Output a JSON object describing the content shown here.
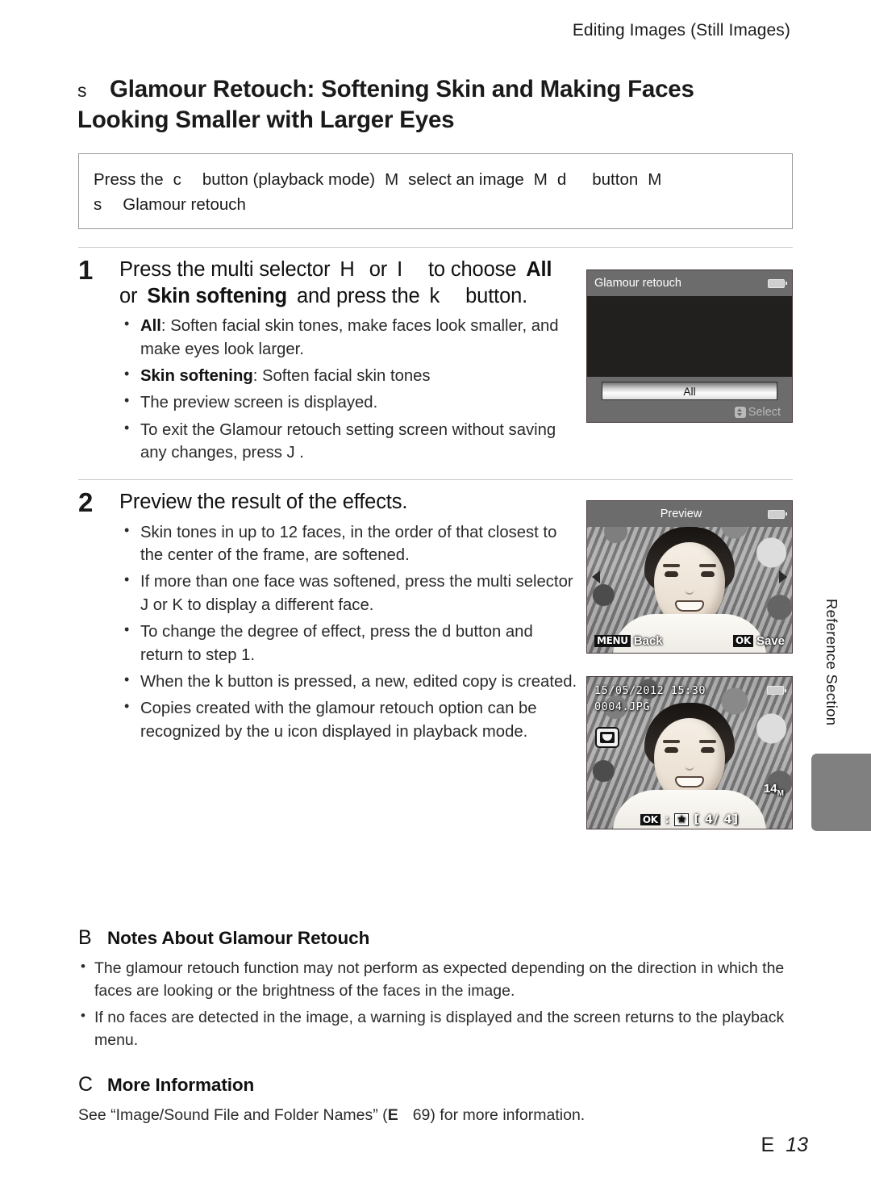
{
  "header": {
    "running_head": "Editing Images (Still Images)"
  },
  "section": {
    "symbol": "s",
    "title_line1": "Glamour Retouch: Softening Skin and Making Faces",
    "title_line2": "Looking Smaller with Larger Eyes"
  },
  "path_box": {
    "line1_a": "Press the",
    "line1_btn1": "c",
    "line1_b": "button (playback mode)",
    "line1_arrow1": "M",
    "line1_c": "select an image",
    "line1_arrow2": "M",
    "line1_btn2": "d",
    "line1_d": "button",
    "line1_arrow3": "M",
    "line2_sym": "s",
    "line2_text": "Glamour retouch"
  },
  "steps": [
    {
      "number": "1",
      "heading_a": "Press the multi selector",
      "heading_sym1": "H",
      "heading_or": "or",
      "heading_sym2": "I",
      "heading_b": "to choose",
      "heading_bold1": "All",
      "heading_c": "or",
      "heading_bold2": "Skin softening",
      "heading_d": "and press the",
      "heading_sym3": "k",
      "heading_e": "button.",
      "bullets": [
        {
          "bold": "All",
          "text": ": Soften facial skin tones, make faces look smaller, and make eyes look larger."
        },
        {
          "bold": "Skin softening",
          "text": ": Soften facial skin tones"
        },
        {
          "bold": "",
          "text": "The preview screen is displayed."
        },
        {
          "bold": "",
          "text": "To exit the Glamour retouch setting screen without saving any changes, press J ."
        }
      ]
    },
    {
      "number": "2",
      "heading": "Preview the result of the effects.",
      "bullets": [
        "Skin tones in up to 12 faces, in the order of that closest to the center of the frame, are softened.",
        "If more than one face was softened, press the multi selector J or K to display a different face.",
        "To change the degree of effect, press the d button and return to step 1.",
        "When the k button is pressed, a new, edited copy is created.",
        "Copies created with the glamour retouch option can be recognized by the u icon displayed in playback mode."
      ]
    }
  ],
  "screens": {
    "screen1": {
      "title": "Glamour retouch",
      "option_label": "All",
      "hint": "Select"
    },
    "screen2": {
      "title": "Preview",
      "hint_left_tag": "MENU",
      "hint_left_label": "Back",
      "hint_right_tag": "OK",
      "hint_right_label": "Save"
    },
    "screen3": {
      "datetime": "15/05/2012 15:30",
      "filename": "0004.JPG",
      "size_badge": "14",
      "size_badge_sub": "M",
      "ok_tag": "OK",
      "colon": ":",
      "star": "★",
      "frame_counter": "[     4/     4]"
    }
  },
  "vertical_tab": {
    "label": "Reference Section"
  },
  "notes": {
    "block1": {
      "mark": "B",
      "title": "Notes About Glamour Retouch",
      "items": [
        "The glamour retouch function may not perform as expected depending on the direction in which the faces are looking or the brightness of the faces in the image.",
        "If no faces are detected in the image, a warning is displayed and the screen returns to the playback menu."
      ]
    },
    "block2": {
      "mark": "C",
      "title": "More Information",
      "text_a": "See “Image/Sound File and Folder Names” (",
      "text_sym": "E",
      "text_b": "69) for more information."
    }
  },
  "footer": {
    "page_prefix": "E",
    "page_number": "13"
  }
}
